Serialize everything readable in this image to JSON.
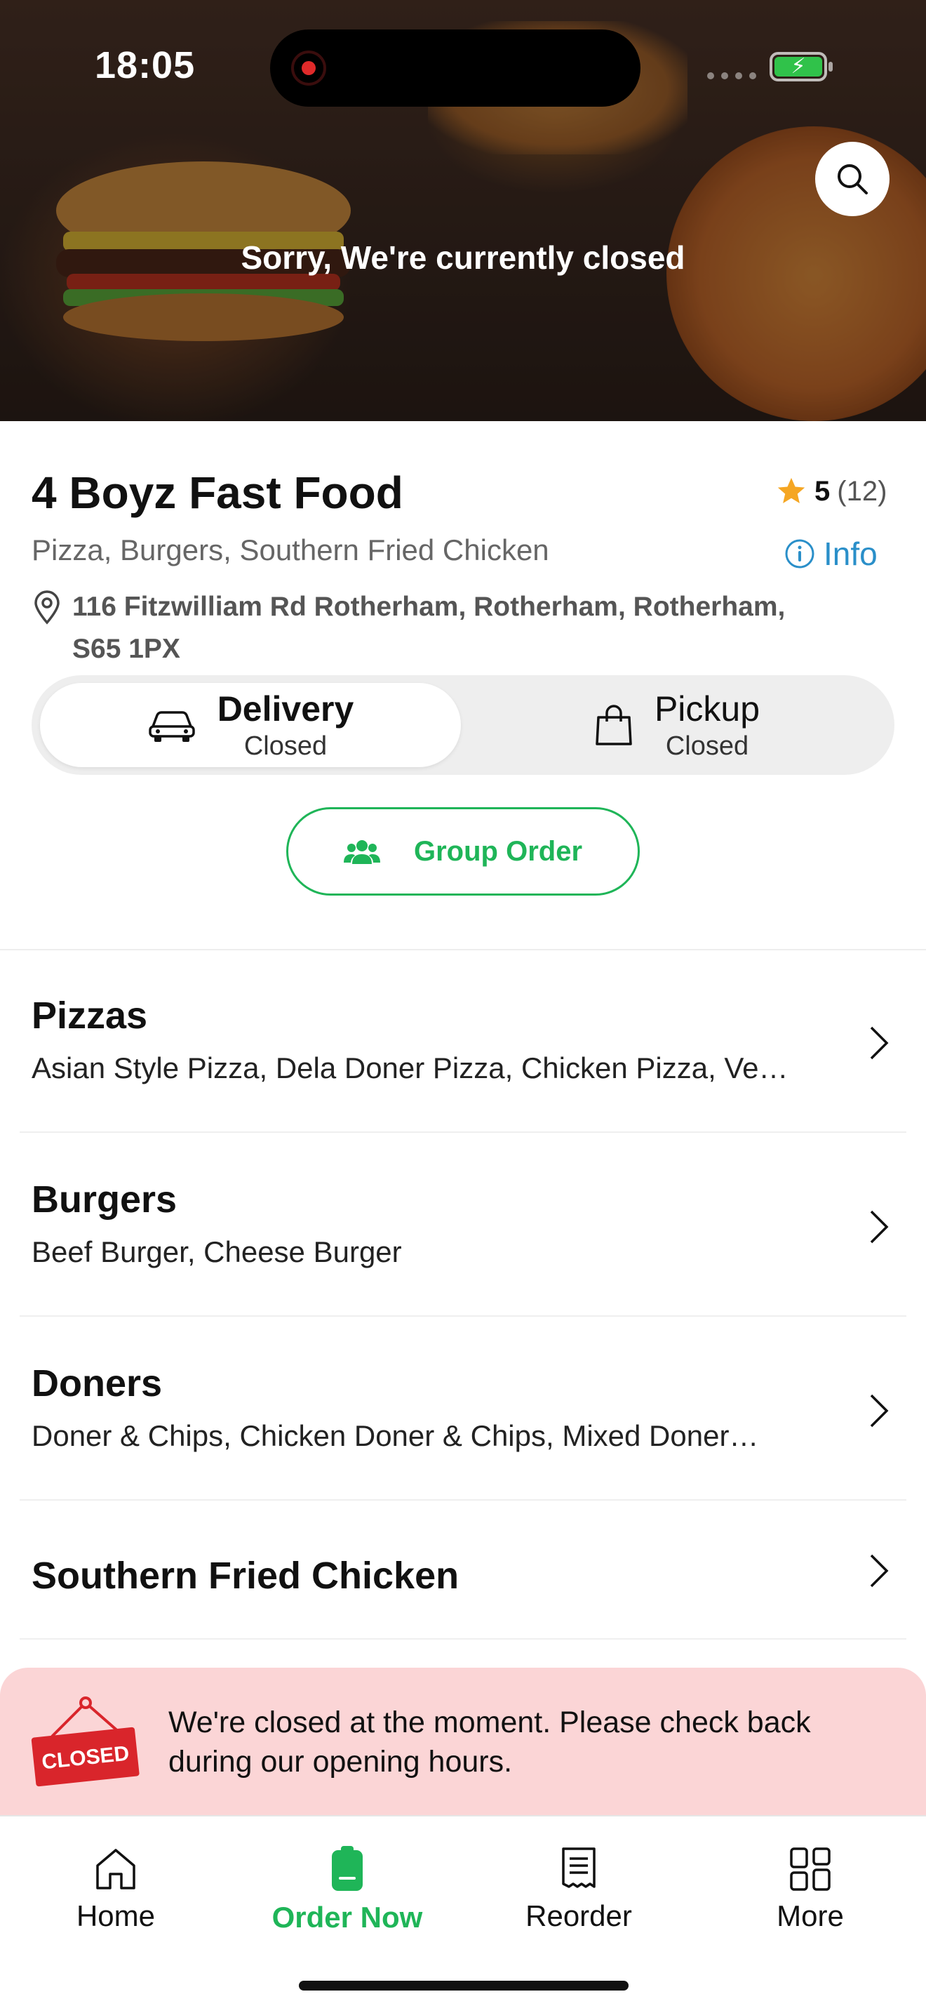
{
  "status_bar": {
    "time": "18:05"
  },
  "hero": {
    "closed_text": "Sorry, We're currently closed"
  },
  "restaurant": {
    "name": "4 Boyz Fast Food",
    "rating": "5",
    "rating_count": "(12)",
    "cuisines": "Pizza, Burgers, Southern Fried Chicken",
    "info_label": "Info",
    "address_line1": "116 Fitzwilliam Rd Rotherham, Rotherham, Rotherham,",
    "address_line2": "S65 1PX"
  },
  "modes": [
    {
      "name": "Delivery",
      "status": "Closed",
      "active": true
    },
    {
      "name": "Pickup",
      "status": "Closed",
      "active": false
    }
  ],
  "group_order": {
    "label": "Group Order"
  },
  "categories": [
    {
      "name": "Pizzas",
      "items": "Asian Style Pizza, Dela Doner Pizza, Chicken Pizza, Ve…"
    },
    {
      "name": "Burgers",
      "items": "Beef Burger, Cheese Burger"
    },
    {
      "name": "Doners",
      "items": "Doner & Chips, Chicken Doner & Chips, Mixed Doner…"
    },
    {
      "name": "Southern Fried Chicken",
      "items": ""
    }
  ],
  "closed_banner": {
    "sign_text": "CLOSED",
    "message": "We're closed at the moment. Please check back during our opening hours."
  },
  "tabs": [
    {
      "label": "Home",
      "icon": "home-icon",
      "active": false
    },
    {
      "label": "Order Now",
      "icon": "order-icon",
      "active": true
    },
    {
      "label": "Reorder",
      "icon": "receipt-icon",
      "active": false
    },
    {
      "label": "More",
      "icon": "grid-icon",
      "active": false
    }
  ],
  "colors": {
    "accent": "#1fb558",
    "info": "#2a8fc9",
    "star": "#f5a623",
    "banner_bg": "#fbd5d6",
    "sign_red": "#d9252b"
  }
}
